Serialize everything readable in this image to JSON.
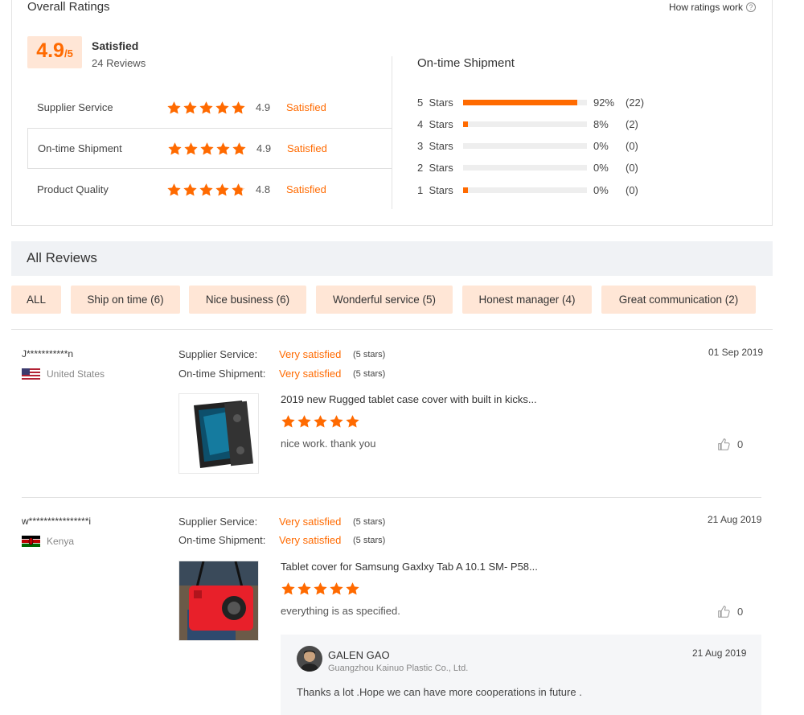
{
  "overall": {
    "title": "Overall Ratings",
    "how_link": "How ratings work",
    "score": "4.9",
    "score_den": "/5",
    "status": "Satisfied",
    "review_count": "24 Reviews",
    "categories": [
      {
        "label": "Supplier Service",
        "score": "4.9",
        "status": "Satisfied",
        "stars": 5
      },
      {
        "label": "On-time Shipment",
        "score": "4.9",
        "status": "Satisfied",
        "stars": 5
      },
      {
        "label": "Product Quality",
        "score": "4.8",
        "status": "Satisfied",
        "stars": 4.8
      }
    ],
    "selected_category": 1
  },
  "distribution": {
    "title": "On-time Shipment",
    "rows": [
      {
        "label": "5  Stars",
        "fraction": 0.92,
        "pct": "92%",
        "count": "(22)"
      },
      {
        "label": "4  Stars",
        "fraction": 0.04,
        "pct": "8%",
        "count": "(2)"
      },
      {
        "label": "3  Stars",
        "fraction": 0,
        "pct": "0%",
        "count": "(0)"
      },
      {
        "label": "2  Stars",
        "fraction": 0,
        "pct": "0%",
        "count": "(0)"
      },
      {
        "label": "1  Stars",
        "fraction": 0.04,
        "pct": "0%",
        "count": "(0)"
      }
    ]
  },
  "all_reviews": {
    "title": "All Reviews",
    "filters": [
      "ALL",
      "Ship on time (6)",
      "Nice business (6)",
      "Wonderful service (5)",
      "Honest manager (4)",
      "Great communication (2)"
    ]
  },
  "reviews": [
    {
      "name": "J***********n",
      "country": "United States",
      "flag": "us",
      "supplier_label": "Supplier Service:",
      "supplier_value": "Very satisfied",
      "supplier_stars": "(5 stars)",
      "shipment_label": "On-time Shipment:",
      "shipment_value": "Very satisfied",
      "shipment_stars": "(5 stars)",
      "date": "01 Sep 2019",
      "product": "2019 new Rugged tablet case cover with built in kicks...",
      "rating": 5,
      "text": "nice work. thank you",
      "likes": "0",
      "image": "black rugged tablet case"
    },
    {
      "name": "w****************i",
      "country": "Kenya",
      "flag": "ke",
      "supplier_label": "Supplier Service:",
      "supplier_value": "Very satisfied",
      "supplier_stars": "(5 stars)",
      "shipment_label": "On-time Shipment:",
      "shipment_value": "Very satisfied",
      "shipment_stars": "(5 stars)",
      "date": "21 Aug 2019",
      "product": "Tablet cover for Samsung Gaxlxy Tab A 10.1 SM- P58...",
      "rating": 5,
      "text": "everything is as specified.",
      "likes": "0",
      "image": "red tablet case with strap"
    }
  ],
  "reply": {
    "name": "GALEN GAO",
    "company": "Guangzhou Kainuo Plastic Co., Ltd.",
    "date": "21 Aug 2019",
    "text": "Thanks a lot .Hope we can have more cooperations in future ."
  },
  "colors": {
    "accent": "#ff6a00",
    "chip_bg": "#ffe6d6",
    "header_bg": "#f0f2f5"
  }
}
